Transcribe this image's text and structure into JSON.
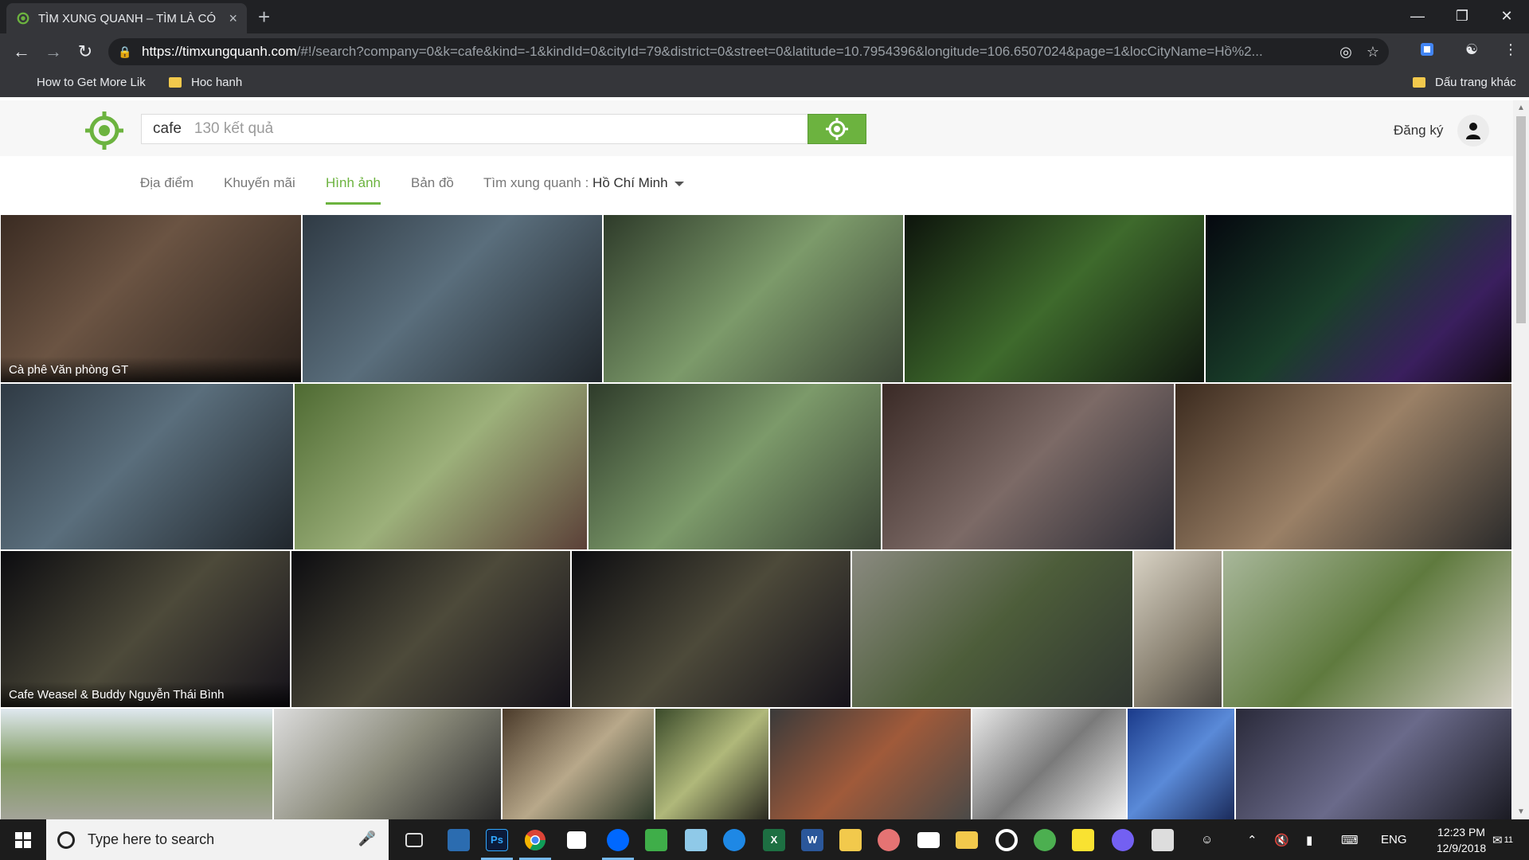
{
  "browser": {
    "tab_title": "TÌM XUNG QUANH – TÌM LÀ CÓ",
    "tab_close": "×",
    "new_tab": "+",
    "url_host": "https://timxungquanh.com",
    "url_rest": "/#!/search?company=0&k=cafe&kind=-1&kindId=0&cityId=79&district=0&street=0&latitude=10.7954396&longitude=106.6507024&page=1&locCityName=Hồ%2...",
    "bookmarks": [
      {
        "label": "How to Get More Lik"
      },
      {
        "label": "Hoc hanh"
      }
    ],
    "other_bookmarks": "Dấu trang khác"
  },
  "header": {
    "query": "cafe",
    "result_count": "130 kết quả",
    "signup": "Đăng ký",
    "brand_color": "#6cb33f"
  },
  "tabs": [
    {
      "label": "Địa điểm"
    },
    {
      "label": "Khuyến mãi"
    },
    {
      "label": "Hình ảnh",
      "active": true
    },
    {
      "label": "Bản đồ"
    }
  ],
  "location": {
    "label": "Tìm xung quanh :",
    "city": "Hồ Chí Minh"
  },
  "photos": [
    {
      "caption": "Cà phê Văn phòng GT",
      "tone": "dark-interior"
    },
    {
      "caption": "",
      "tone": "people-laptops"
    },
    {
      "caption": "",
      "tone": "green-plants"
    },
    {
      "caption": "",
      "tone": "night-plants"
    },
    {
      "caption": "",
      "tone": "night-terrace"
    },
    {
      "caption": "",
      "tone": "people-laptops"
    },
    {
      "caption": "",
      "tone": "street-tree"
    },
    {
      "caption": "",
      "tone": "green-plants"
    },
    {
      "caption": "",
      "tone": "interior-screens"
    },
    {
      "caption": "",
      "tone": "panorama"
    },
    {
      "caption": "Cafe Weasel & Buddy Nguyễn Thái Bình",
      "tone": "night-exterior"
    },
    {
      "caption": "",
      "tone": "night-exterior"
    },
    {
      "caption": "",
      "tone": "night-exterior"
    },
    {
      "caption": "",
      "tone": "crowd-day"
    },
    {
      "caption": "",
      "tone": "restroom"
    },
    {
      "caption": "",
      "tone": "street-day"
    },
    {
      "caption": "",
      "tone": "trees-sky"
    },
    {
      "caption": "",
      "tone": "drink-white"
    },
    {
      "caption": "",
      "tone": "shop-counter"
    },
    {
      "caption": "",
      "tone": "drinks-green"
    },
    {
      "caption": "",
      "tone": "menu-board"
    },
    {
      "caption": "",
      "tone": "raccoon-mural"
    },
    {
      "caption": "",
      "tone": "blue-logo"
    },
    {
      "caption": "",
      "tone": "group-photo"
    }
  ],
  "taskbar": {
    "search_placeholder": "Type here to search",
    "apps": [
      "task-view",
      "file-explorer-alt",
      "photoshop",
      "chrome",
      "store",
      "zalo",
      "camtasia",
      "notepad",
      "edge",
      "excel",
      "word",
      "file-manager",
      "paint",
      "mail",
      "folder",
      "opera",
      "leaf-app",
      "sticky-notes",
      "viber",
      "photos"
    ],
    "ps_label": "Ps",
    "lang": "ENG",
    "time": "12:23 PM",
    "date": "12/9/2018",
    "notif_count": "11"
  }
}
